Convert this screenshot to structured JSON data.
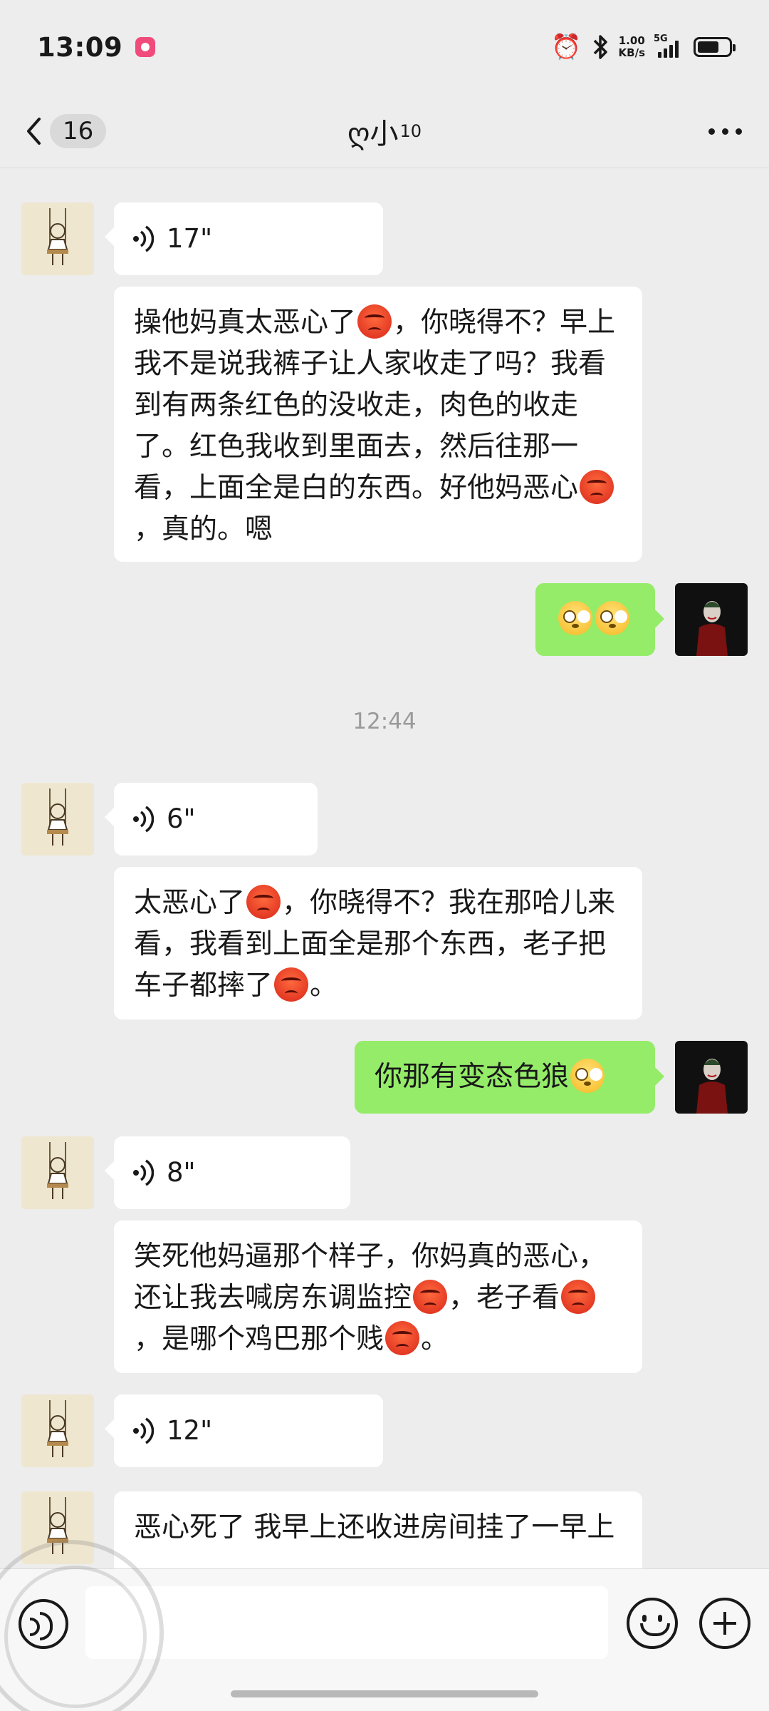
{
  "status_bar": {
    "time": "13:09",
    "net_speed_value": "1.00",
    "net_speed_unit": "KB/s",
    "network_type": "5G",
    "icons": [
      "notification-app-icon",
      "alarm-icon",
      "bluetooth-icon",
      "signal-icon",
      "battery-icon"
    ]
  },
  "nav": {
    "unread_count": "16",
    "title": "ღ小",
    "title_sup": "10"
  },
  "messages": [
    {
      "sender": "them",
      "type": "voice",
      "duration": "17\""
    },
    {
      "sender": "them",
      "type": "text",
      "parts": [
        "操他妈真太恶心了",
        "[angry]",
        "，你晓得不？早上我不是说我裤子让人家收走了吗？我看到有两条红色的没收走，肉色的收走了。红色我收到里面去，然后往那一看，上面全是白的东西。好他妈恶心",
        "[angry]",
        "，真的。嗯"
      ]
    },
    {
      "sender": "me",
      "type": "text",
      "parts": [
        "[flushed]",
        "[flushed]"
      ]
    },
    {
      "type": "time",
      "text": "12:44"
    },
    {
      "sender": "them",
      "type": "voice",
      "duration": "6\""
    },
    {
      "sender": "them",
      "type": "text",
      "parts": [
        "太恶心了",
        "[angry]",
        "，你晓得不？我在那哈儿来看，我看到上面全是那个东西，老子把车子都摔了",
        "[angry]",
        "。"
      ]
    },
    {
      "sender": "me",
      "type": "text",
      "parts": [
        "你那有变态色狼",
        "[flushed]"
      ]
    },
    {
      "sender": "them",
      "type": "voice",
      "duration": "8\""
    },
    {
      "sender": "them",
      "type": "text",
      "parts": [
        "笑死他妈逼那个样子，你妈真的恶心，还让我去喊房东调监控",
        "[angry]",
        "，老子看",
        "[angry]",
        "，是哪个鸡巴那个贱",
        "[angry]",
        "。"
      ]
    },
    {
      "sender": "them",
      "type": "voice",
      "duration": "12\""
    },
    {
      "sender": "them",
      "type": "text",
      "parts": [
        "恶心死了  我早上还收进房间挂了一早上"
      ]
    }
  ],
  "input_bar": {
    "placeholder": "",
    "icons": [
      "voice-toggle-icon",
      "emoji-icon",
      "plus-icon"
    ]
  },
  "colors": {
    "chat_background": "#ededed",
    "incoming_bubble": "#ffffff",
    "outgoing_bubble": "#95ec69",
    "timestamp_text": "#9a9a9a"
  }
}
